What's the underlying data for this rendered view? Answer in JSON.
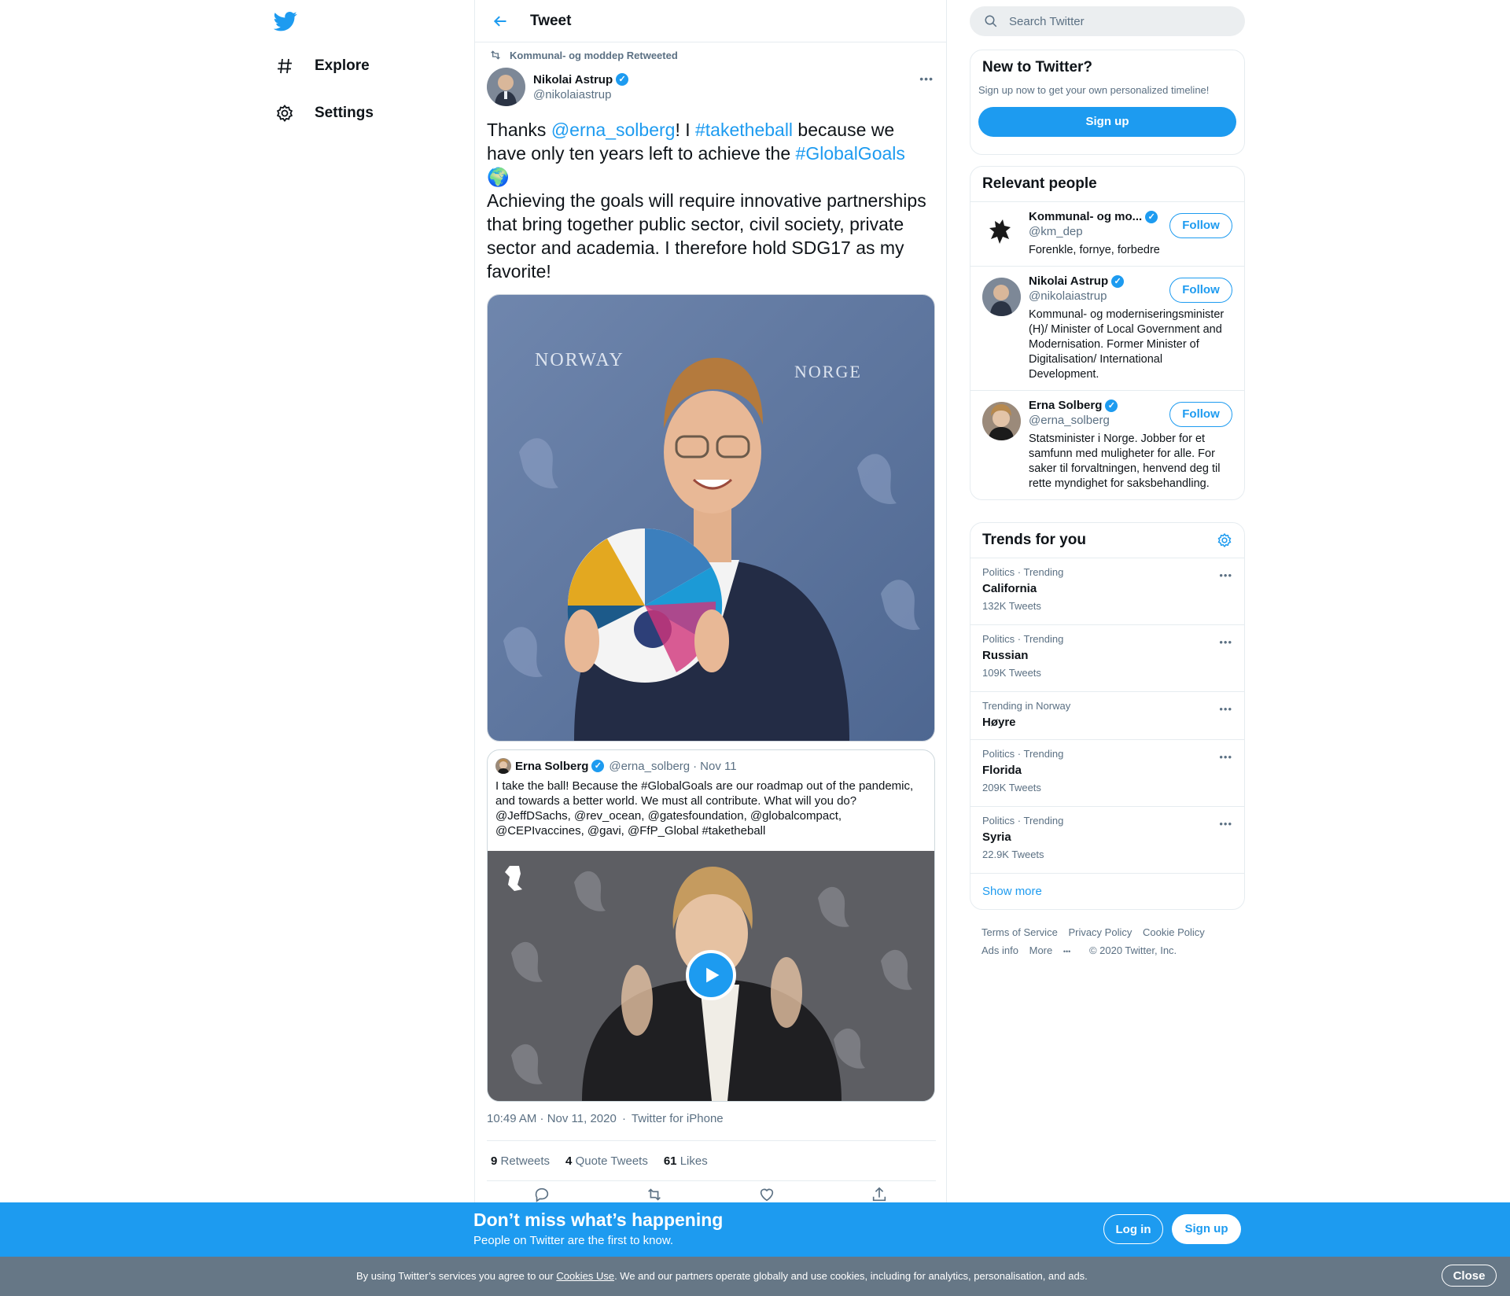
{
  "nav": {
    "logo_icon": "twitter-bird-icon",
    "items": [
      {
        "label": "Explore",
        "icon": "hashtag-icon"
      },
      {
        "label": "Settings",
        "icon": "gear-icon"
      }
    ]
  },
  "header": {
    "title": "Tweet",
    "back_icon": "back-arrow-icon"
  },
  "tweet": {
    "retweeted_by": "Kommunal- og moddep Retweeted",
    "author_name": "Nikolai Astrup",
    "author_handle": "@nikolaiastrup",
    "text_part1": "Thanks ",
    "mention1": "@erna_solberg",
    "text_part2": "! I ",
    "hashtag1": "#taketheball",
    "text_part3": " because we have only ten years left to achieve the ",
    "hashtag2": "#GlobalGoals",
    "emoji": "🌍",
    "text_part4": "Achieving the goals will require innovative partnerships that bring together public sector, civil society, private sector and academia. I therefore hold SDG17 as my favorite!",
    "image_alt": "Man in suit holding a Global Goals football in front of a Norway backdrop",
    "timestamp": "10:49 AM · Nov 11, 2020",
    "source": "Twitter for iPhone",
    "stats": {
      "retweets_count": "9",
      "retweets_label": "Retweets",
      "quotes_count": "4",
      "quotes_label": "Quote Tweets",
      "likes_count": "61",
      "likes_label": "Likes"
    }
  },
  "quote": {
    "name": "Erna Solberg",
    "handle": "@erna_solberg",
    "date": "Nov 11",
    "text": "I take the ball! Because the #GlobalGoals are our roadmap out of the pandemic, and towards a better world. We must all contribute. What will you do? @JeffDSachs, @rev_ocean, @gatesfoundation, @globalcompact, @CEPIvaccines, @gavi, @FfP_Global #taketheball"
  },
  "search": {
    "placeholder": "Search Twitter"
  },
  "new_to_twitter": {
    "title": "New to Twitter?",
    "subtitle": "Sign up now to get your own personalized timeline!",
    "button": "Sign up"
  },
  "relevant_people": {
    "title": "Relevant people",
    "follow_label": "Follow",
    "people": [
      {
        "name": "Kommunal- og mo...",
        "handle": "@km_dep",
        "bio": "Forenkle, fornye, forbedre"
      },
      {
        "name": "Nikolai Astrup",
        "handle": "@nikolaiastrup",
        "bio": "Kommunal- og moderniseringsminister (H)/ Minister of Local Government and Modernisation. Former Minister of Digitalisation/ International Development."
      },
      {
        "name": "Erna Solberg",
        "handle": "@erna_solberg",
        "bio": "Statsminister i Norge. Jobber for et samfunn med muligheter for alle. For saker til forvaltningen, henvend deg til rette myndighet for saksbehandling."
      }
    ]
  },
  "trends": {
    "title": "Trends for you",
    "items": [
      {
        "meta": "Politics · Trending",
        "name": "California",
        "count": "132K Tweets"
      },
      {
        "meta": "Politics · Trending",
        "name": "Russian",
        "count": "109K Tweets"
      },
      {
        "meta": "Trending in Norway",
        "name": "Høyre",
        "count": ""
      },
      {
        "meta": "Politics · Trending",
        "name": "Florida",
        "count": "209K Tweets"
      },
      {
        "meta": "Politics · Trending",
        "name": "Syria",
        "count": "22.9K Tweets"
      }
    ],
    "show_more": "Show more"
  },
  "footer": {
    "terms": "Terms of Service",
    "privacy": "Privacy Policy",
    "cookie": "Cookie Policy",
    "ads": "Ads info",
    "more": "More",
    "copyright": "© 2020 Twitter, Inc."
  },
  "banner": {
    "headline": "Don’t miss what’s happening",
    "sub": "People on Twitter are the first to know.",
    "login": "Log in",
    "signup": "Sign up"
  },
  "cookie_bar": {
    "text_before": "By using Twitter’s services you agree to our ",
    "link": "Cookies Use",
    "text_after": ". We and our partners operate globally and use cookies, including for analytics, personalisation, and ads.",
    "close": "Close"
  },
  "colors": {
    "accent": "#1d9bf0",
    "text": "#0f1419",
    "muted": "#5b7083",
    "cookie_bg": "#667786"
  }
}
